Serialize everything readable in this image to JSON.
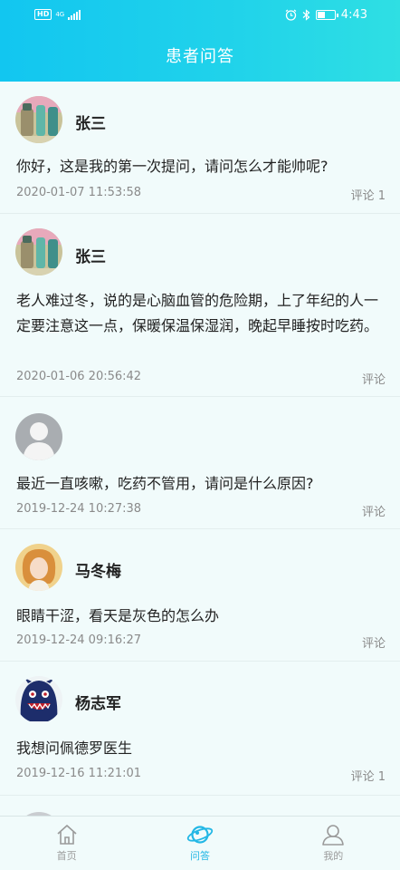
{
  "status_bar": {
    "hd_label": "HD",
    "network": "4G",
    "network_sub": "ll",
    "time": "4:43"
  },
  "header": {
    "title": "患者问答"
  },
  "questions": [
    {
      "user": "张三",
      "avatar": "product-photo-avatar",
      "text": "你好，这是我的第一次提问，请问怎么才能帅呢?",
      "date": "2020-01-07 11:53:58",
      "comment": "评论 1"
    },
    {
      "user": "张三",
      "avatar": "product-photo-avatar",
      "text": "老人难过冬，说的是心脑血管的危险期，上了年纪的人一定要注意这一点，保暖保温保湿润，晚起早睡按时吃药。",
      "date": "2020-01-06 20:56:42",
      "comment": "评论"
    },
    {
      "user": "",
      "avatar": "default-user-avatar",
      "text": "最近一直咳嗽，吃药不管用，请问是什么原因?",
      "date": "2019-12-24 10:27:38",
      "comment": "评论"
    },
    {
      "user": "马冬梅",
      "avatar": "woman-photo-avatar",
      "text": "眼睛干涩，看天是灰色的怎么办",
      "date": "2019-12-24 09:16:27",
      "comment": "评论"
    },
    {
      "user": "杨志军",
      "avatar": "monster-avatar",
      "text": "我想问佩德罗医生",
      "date": "2019-12-16 11:21:01",
      "comment": "评论 1"
    }
  ],
  "tabbar": {
    "tabs": [
      {
        "label": "首页",
        "icon": "home-icon",
        "active": false
      },
      {
        "label": "问答",
        "icon": "planet-icon",
        "active": true
      },
      {
        "label": "我的",
        "icon": "person-icon",
        "active": false
      }
    ]
  },
  "colors": {
    "header_start": "#12c6f0",
    "header_end": "#2fdfe3",
    "background": "#f1fbfb",
    "active_tab": "#23b7e5",
    "muted_text": "#8a8a8a"
  }
}
